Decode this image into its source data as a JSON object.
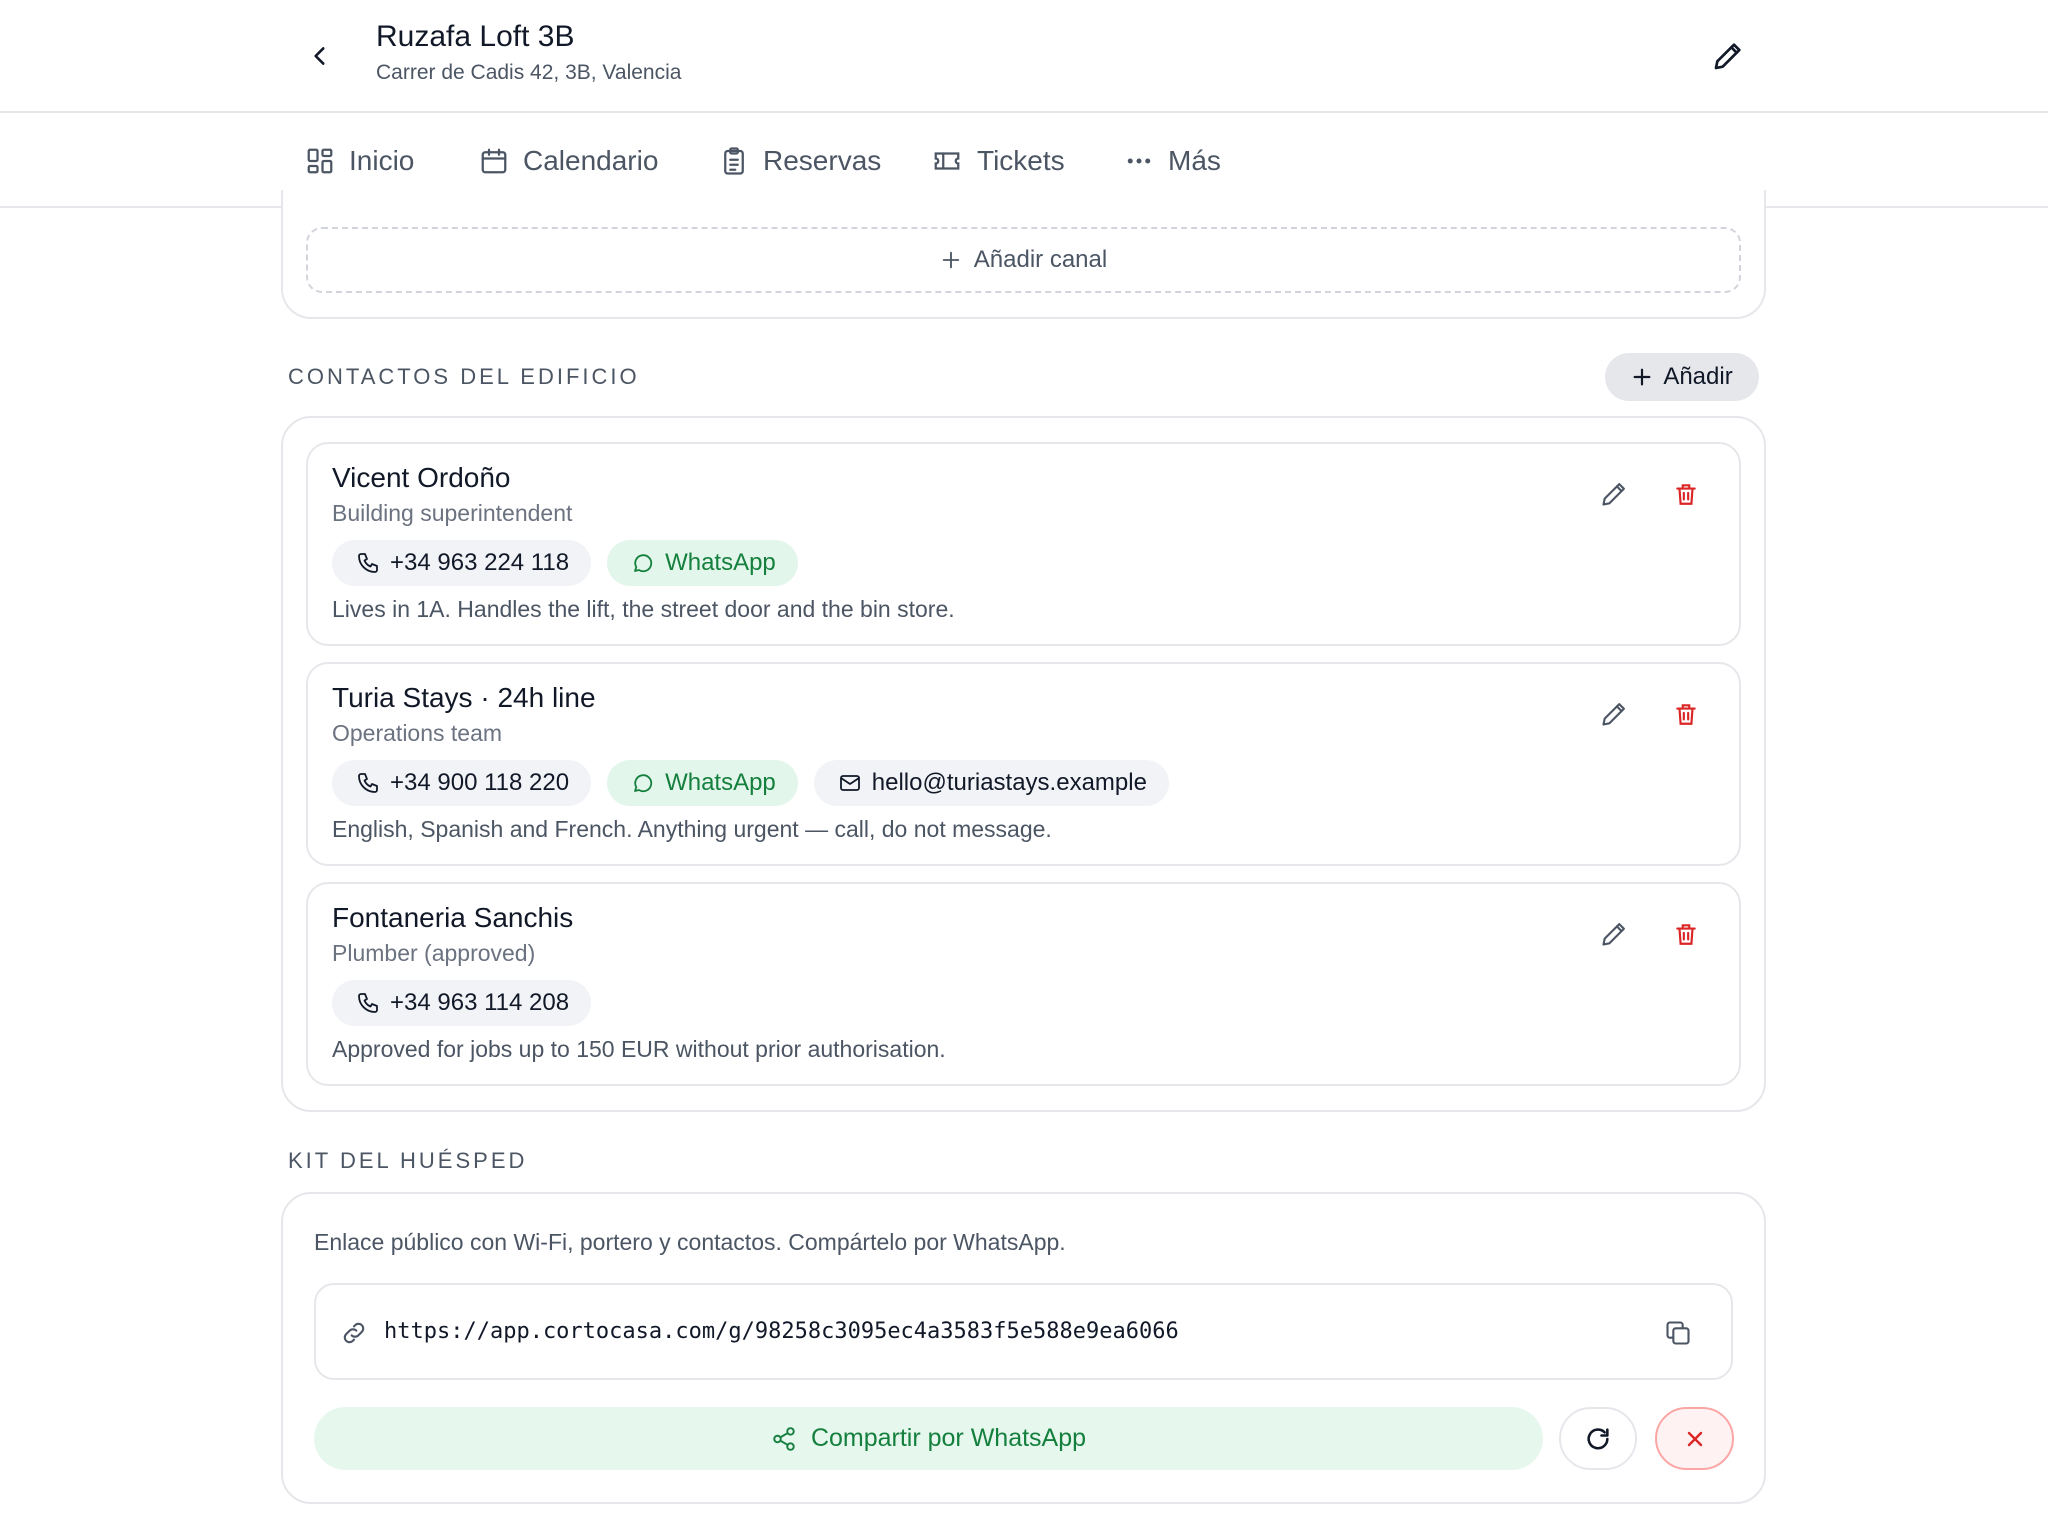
{
  "header": {
    "title": "Ruzafa Loft 3B",
    "subtitle": "Carrer de Cadis 42, 3B, Valencia",
    "back_icon": "chevron-left-icon",
    "edit_icon": "pencil-icon"
  },
  "tabs": [
    {
      "label": "Inicio",
      "icon": "grid-icon"
    },
    {
      "label": "Calendario",
      "icon": "calendar-icon"
    },
    {
      "label": "Reservas",
      "icon": "clipboard-icon"
    },
    {
      "label": "Tickets",
      "icon": "ticket-icon"
    },
    {
      "label": "Más",
      "icon": "more-icon"
    }
  ],
  "channels": {
    "add_label": "Añadir canal"
  },
  "contacts_section": {
    "title": "CONTACTOS DEL EDIFICIO",
    "add_label": "Añadir",
    "items": [
      {
        "name": "Vicent Ordoño",
        "role": "Building superintendent",
        "phone": "+34 963 224 118",
        "whatsapp": "WhatsApp",
        "note": "Lives in 1A. Handles the lift, the street door and the bin store."
      },
      {
        "name": "Turia Stays · 24h line",
        "role": "Operations team",
        "phone": "+34 900 118 220",
        "whatsapp": "WhatsApp",
        "email": "hello@turiastays.example",
        "note": "English, Spanish and French. Anything urgent — call, do not message."
      },
      {
        "name": "Fontaneria Sanchis",
        "role": "Plumber (approved)",
        "phone": "+34 963 114 208",
        "note": "Approved for jobs up to 150 EUR without prior authorisation."
      }
    ]
  },
  "guest_kit": {
    "title": "KIT DEL HUÉSPED",
    "description": "Enlace público con Wi-Fi, portero y contactos. Compártelo por WhatsApp.",
    "link": "https://app.cortocasa.com/g/98258c3095ec4a3583f5e588e9ea6066",
    "share_label": "Compartir por WhatsApp"
  },
  "colors": {
    "whatsapp_green": "#15803d",
    "whatsapp_bg": "#e3f6ec",
    "danger_red": "#dc2626",
    "muted_text": "#4b5563",
    "border": "#e5e7eb"
  }
}
